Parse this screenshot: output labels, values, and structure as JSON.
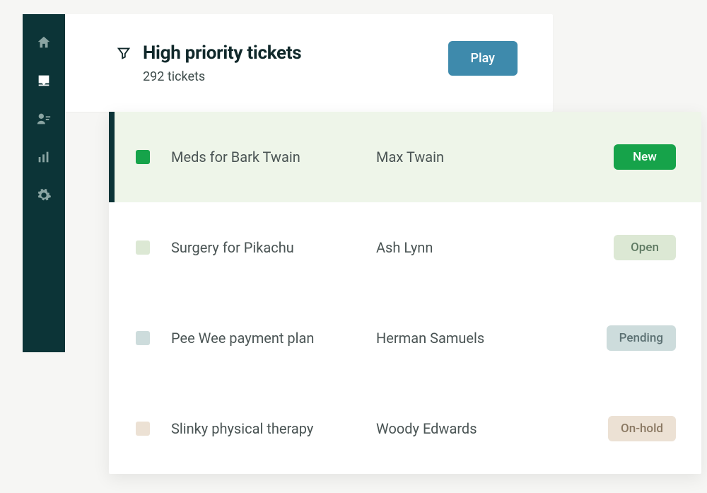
{
  "sidebar": {
    "items": [
      {
        "name": "home-icon"
      },
      {
        "name": "inbox-icon",
        "active": true
      },
      {
        "name": "contacts-icon"
      },
      {
        "name": "reports-icon"
      },
      {
        "name": "settings-icon"
      }
    ]
  },
  "header": {
    "title": "High priority tickets",
    "subtitle": "292 tickets",
    "play_label": "Play"
  },
  "tickets": [
    {
      "subject": "Meds for Bark Twain",
      "requester": "Max Twain",
      "status_label": "New",
      "status_key": "new",
      "selected": true
    },
    {
      "subject": "Surgery for Pikachu",
      "requester": "Ash Lynn",
      "status_label": "Open",
      "status_key": "open",
      "selected": false
    },
    {
      "subject": "Pee Wee payment plan",
      "requester": "Herman Samuels",
      "status_label": "Pending",
      "status_key": "pending",
      "selected": false
    },
    {
      "subject": "Slinky physical therapy",
      "requester": "Woody Edwards",
      "status_label": "On-hold",
      "status_key": "onhold",
      "selected": false
    }
  ]
}
